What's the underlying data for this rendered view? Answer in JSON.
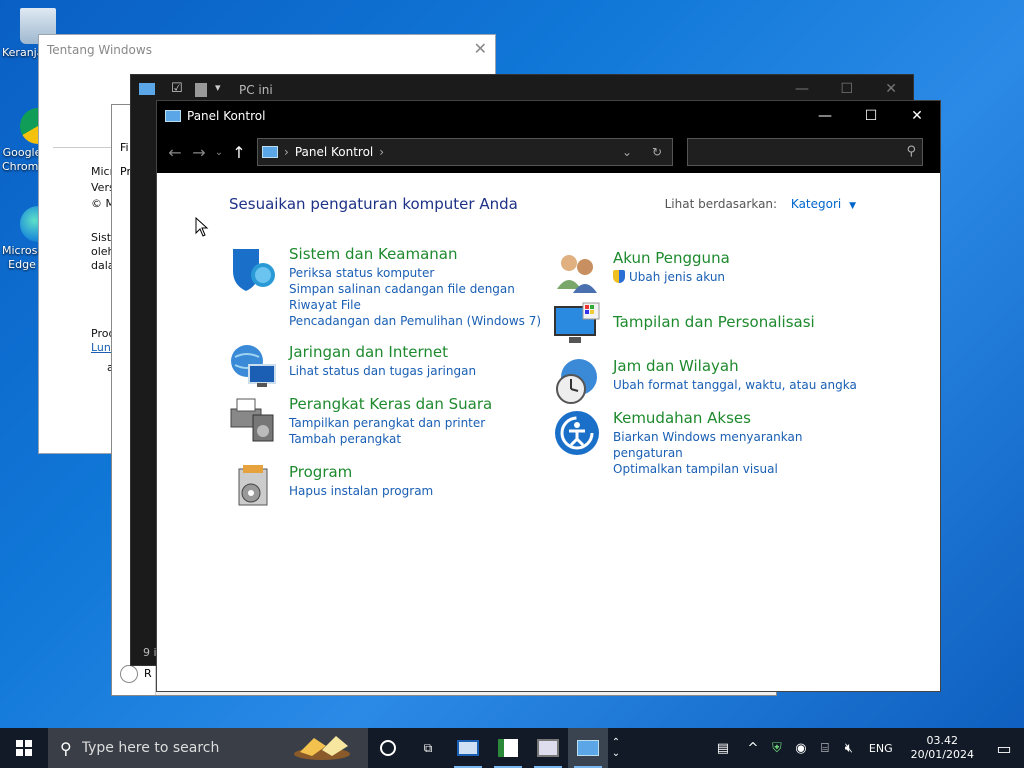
{
  "desktop": {
    "icons": [
      {
        "label": "Keranjang Sampah",
        "icon": "recycle-bin-icon"
      },
      {
        "label": "Google Chrome",
        "icon": "chrome-icon"
      },
      {
        "label": "Microsoft Edge",
        "icon": "edge-icon"
      }
    ]
  },
  "about_window": {
    "title": "Tentang Windows",
    "lines": [
      "Micro",
      "Versi",
      "© M",
      "Siste",
      "oleh",
      "dala",
      "Prod",
      "Luna",
      "a"
    ]
  },
  "pc_window": {
    "title": "PC ini",
    "footer": "9 i"
  },
  "mid_window": {
    "fi": "Fi",
    "pr": "Pr",
    "r": "R"
  },
  "control_panel": {
    "title": "Panel Kontrol",
    "breadcrumb": "Panel Kontrol",
    "search_placeholder": "",
    "heading": "Sesuaikan pengaturan komputer Anda",
    "view_by_label": "Lihat berdasarkan:",
    "view_by_value": "Kategori",
    "left_categories": [
      {
        "title": "Sistem dan Keamanan",
        "links": [
          "Periksa status komputer",
          "Simpan salinan cadangan file dengan Riwayat File",
          "Pencadangan dan Pemulihan (Windows 7)"
        ]
      },
      {
        "title": "Jaringan dan Internet",
        "links": [
          "Lihat status dan tugas jaringan"
        ]
      },
      {
        "title": "Perangkat Keras dan Suara",
        "links": [
          "Tampilkan perangkat dan printer",
          "Tambah perangkat"
        ]
      },
      {
        "title": "Program",
        "links": [
          "Hapus instalan program"
        ]
      }
    ],
    "right_categories": [
      {
        "title": "Akun Pengguna",
        "links": [
          "Ubah jenis akun"
        ]
      },
      {
        "title": "Tampilan dan Personalisasi",
        "links": []
      },
      {
        "title": "Jam dan Wilayah",
        "links": [
          "Ubah format tanggal, waktu, atau angka"
        ]
      },
      {
        "title": "Kemudahan Akses",
        "links": [
          "Biarkan Windows menyarankan pengaturan",
          "Optimalkan tampilan visual"
        ]
      }
    ]
  },
  "taskbar": {
    "search_placeholder": "Type here to search",
    "language": "ENG",
    "time": "03.42",
    "date": "20/01/2024"
  },
  "colors": {
    "category_title": "#1e8a2e",
    "link": "#1a5fb4",
    "heading": "#1e3287"
  }
}
